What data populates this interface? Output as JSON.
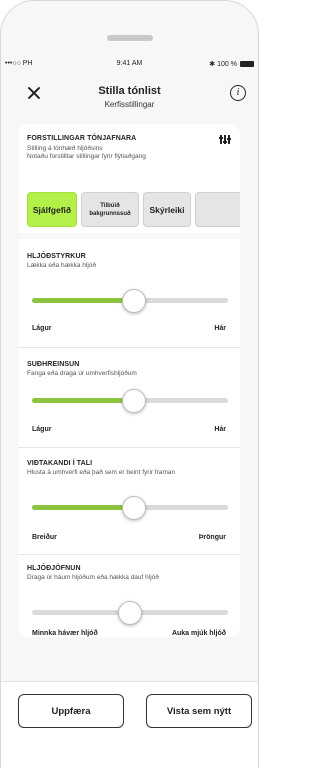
{
  "status": {
    "carrier": "•••○○ PH",
    "time": "9:41 AM",
    "battery": "100 %"
  },
  "header": {
    "title": "Stilla tónlist",
    "subtitle": "Kerfisstillingar"
  },
  "eq": {
    "title": "FORSTILLINGAR TÓNJAFNARA",
    "desc1": "Stilling á tónhæð hljóðsins",
    "desc2": "Notaðu forstilltar stillingar fyrir flýtiaðgang",
    "presets": [
      {
        "label": "Sjálfgefið",
        "active": true
      },
      {
        "label_line1": "Tilbúið",
        "label_line2": "bakgrunnssuð",
        "active": false
      },
      {
        "label": "Skýrleiki",
        "active": false
      },
      {
        "label": "",
        "active": false
      }
    ]
  },
  "sliders": [
    {
      "title": "HLJÓÐSTYRKUR",
      "desc": "Lækka eða hækka hljóð",
      "min": "Lágur",
      "max": "Hár",
      "value": 0.52,
      "filled": true
    },
    {
      "title": "SUÐHREINSUN",
      "desc": "Fanga eða draga úr umhverfishljóðum",
      "min": "Lágur",
      "max": "Hár",
      "value": 0.52,
      "filled": true
    },
    {
      "title": "VIÐTAKANDI Í TALI",
      "desc": "Hlusta á umhverfi eða það sem er beint fyrir framan",
      "min": "Breiður",
      "max": "Þröngur",
      "value": 0.52,
      "filled": true
    },
    {
      "title": "HLJÓÐJÖFNUN",
      "desc": "Draga úr háum hljóðum eða hækka dauf hljóð",
      "min": "Minnka hávær hljóð",
      "max": "Auka mjúk hljóð",
      "value": 0.5,
      "filled": false
    }
  ],
  "footer": {
    "update": "Uppfæra",
    "save_new": "Vista sem nýtt"
  },
  "colors": {
    "accent": "#8bc53f",
    "preset_active": "#b4f04a"
  }
}
